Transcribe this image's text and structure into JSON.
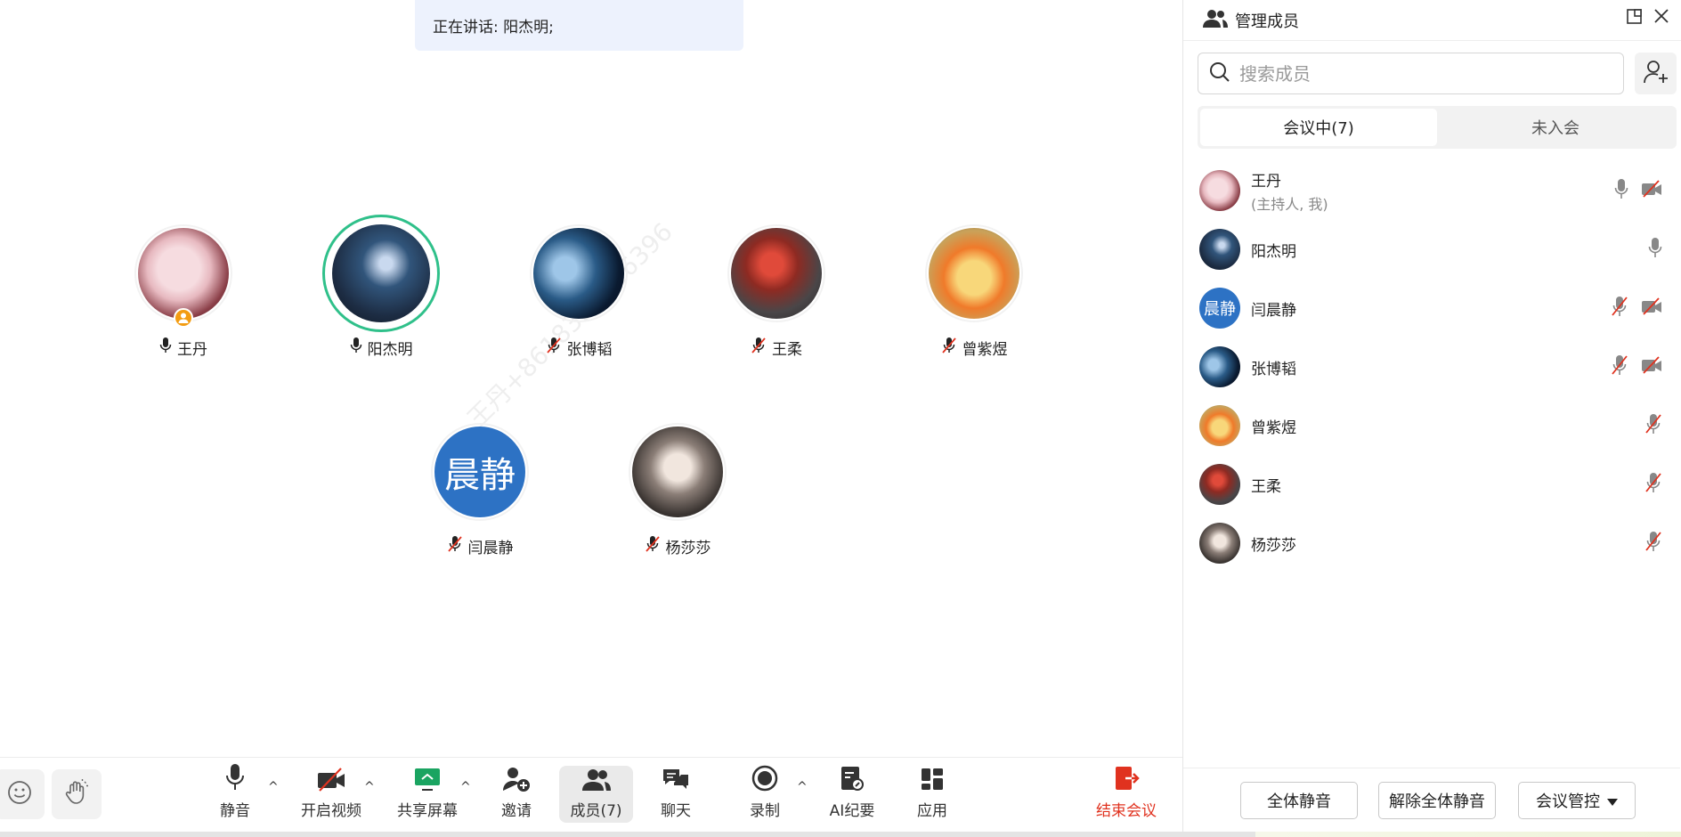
{
  "stage": {
    "speaking_banner": "正在讲话: 阳杰明;",
    "watermark": "王丹+8618323816396",
    "participants": [
      {
        "name": "王丹",
        "mic": "on",
        "host": true,
        "speaking": false
      },
      {
        "name": "阳杰明",
        "mic": "on",
        "host": false,
        "speaking": true
      },
      {
        "name": "张博韬",
        "mic": "muted",
        "host": false,
        "speaking": false
      },
      {
        "name": "王柔",
        "mic": "muted",
        "host": false,
        "speaking": false
      },
      {
        "name": "曾紫煜",
        "mic": "muted",
        "host": false,
        "speaking": false
      },
      {
        "name": "闫晨静",
        "mic": "muted",
        "host": false,
        "speaking": false,
        "avatar_text": "晨静"
      },
      {
        "name": "杨莎莎",
        "mic": "muted",
        "host": false,
        "speaking": false
      }
    ]
  },
  "toolbar": {
    "mute": "静音",
    "video": "开启视频",
    "share": "共享屏幕",
    "invite": "邀请",
    "members": "成员(7)",
    "chat": "聊天",
    "record": "录制",
    "ai_minutes": "AI纪要",
    "apps": "应用",
    "end": "结束会议",
    "end_color": "#e0321f"
  },
  "panel": {
    "title": "管理成员",
    "search_placeholder": "搜索成员",
    "tabs": [
      {
        "label": "会议中(7)",
        "active": true
      },
      {
        "label": "未入会",
        "active": false
      }
    ],
    "members": [
      {
        "name": "王丹",
        "role": "(主持人, 我)",
        "mic": "on",
        "video": "off"
      },
      {
        "name": "阳杰明",
        "role": "",
        "mic": "on",
        "video": "none"
      },
      {
        "name": "闫晨静",
        "role": "",
        "mic": "muted",
        "video": "off",
        "avatar_text": "晨静"
      },
      {
        "name": "张博韬",
        "role": "",
        "mic": "muted",
        "video": "off"
      },
      {
        "name": "曾紫煜",
        "role": "",
        "mic": "muted",
        "video": "none"
      },
      {
        "name": "王柔",
        "role": "",
        "mic": "muted",
        "video": "none"
      },
      {
        "name": "杨莎莎",
        "role": "",
        "mic": "muted",
        "video": "none"
      }
    ],
    "footer": {
      "mute_all": "全体静音",
      "unmute_all": "解除全体静音",
      "control": "会议管控"
    }
  },
  "colors": {
    "speaking_ring": "#2fc08a",
    "host_badge": "#f39c12",
    "text_avatar_bg": "#2d72c4",
    "muted_red": "#e0321f"
  }
}
